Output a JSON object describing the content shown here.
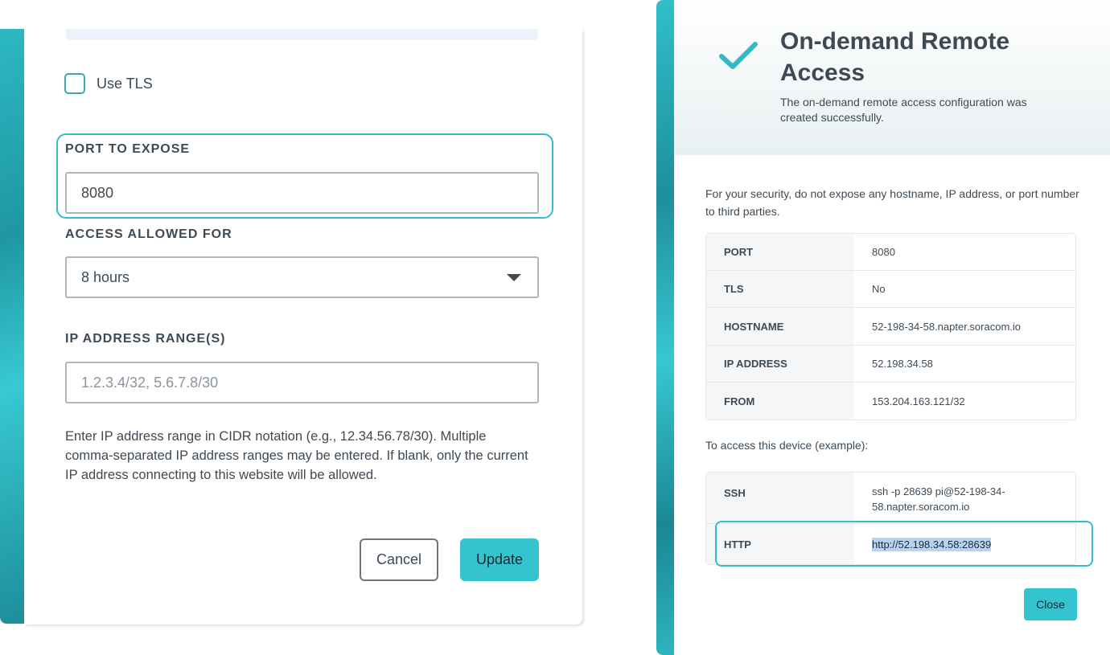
{
  "left_form": {
    "use_tls_label": "Use TLS",
    "use_tls_checked": false,
    "port_label": "PORT TO EXPOSE",
    "port_value": "8080",
    "access_label": "ACCESS ALLOWED FOR",
    "access_value": "8 hours",
    "ip_label": "IP ADDRESS RANGE(S)",
    "ip_placeholder": "1.2.3.4/32, 5.6.7.8/30",
    "ip_value": "",
    "help_text": "Enter IP address range in CIDR notation (e.g., 12.34.56.78/30). Multiple comma-separated IP address ranges may be entered. If blank, only the current IP address connecting to this website will be allowed.",
    "cancel_label": "Cancel",
    "update_label": "Update"
  },
  "modal": {
    "title": "On-demand Remote Access",
    "subtitle": "The on-demand remote access configuration was created successfully.",
    "security_note": "For your security, do not expose any hostname, IP address, or port number to third parties.",
    "details": [
      {
        "key": "PORT",
        "value": "8080"
      },
      {
        "key": "TLS",
        "value": "No"
      },
      {
        "key": "HOSTNAME",
        "value": "52-198-34-58.napter.soracom.io"
      },
      {
        "key": "IP ADDRESS",
        "value": "52.198.34.58"
      },
      {
        "key": "FROM",
        "value": "153.204.163.121/32"
      }
    ],
    "access_example_label": "To access this device (example):",
    "examples": [
      {
        "key": "SSH",
        "value": "ssh -p 28639 pi@52-198-34-58.napter.soracom.io"
      },
      {
        "key": "HTTP",
        "value": "http://52.198.34.58:28639"
      }
    ],
    "close_label": "Close"
  },
  "colors": {
    "accent": "#33c4d0",
    "highlight_border": "#35bcc8",
    "text": "#3d4a55",
    "selection": "#b8d4f3"
  },
  "icons": {
    "success": "checkmark-icon",
    "dropdown": "caret-down-icon"
  }
}
